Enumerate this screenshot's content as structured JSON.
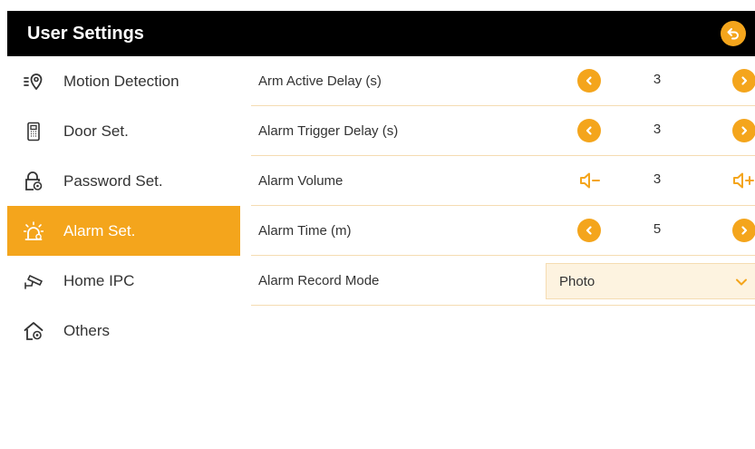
{
  "header": {
    "title": "User Settings",
    "back_icon": "back-arrow-icon"
  },
  "colors": {
    "accent": "#f4a51c",
    "titlebar": "#000000",
    "divider": "#f5dcb2",
    "select_bg": "#fdf3e0"
  },
  "sidebar": {
    "items": [
      {
        "label": "Motion Detection",
        "icon": "motion-sensor-icon",
        "active": false
      },
      {
        "label": "Door Set.",
        "icon": "door-phone-icon",
        "active": false
      },
      {
        "label": "Password Set.",
        "icon": "lock-settings-icon",
        "active": false
      },
      {
        "label": "Alarm Set.",
        "icon": "alarm-light-icon",
        "active": true
      },
      {
        "label": "Home IPC",
        "icon": "cctv-camera-icon",
        "active": false
      },
      {
        "label": "Others",
        "icon": "home-settings-icon",
        "active": false
      }
    ]
  },
  "settings": {
    "rows": [
      {
        "label": "Arm Active Delay (s)",
        "value": "3",
        "control": "stepper",
        "dec_icon": "chevron-left-icon",
        "inc_icon": "chevron-right-icon"
      },
      {
        "label": "Alarm Trigger Delay (s)",
        "value": "3",
        "control": "stepper",
        "dec_icon": "chevron-left-icon",
        "inc_icon": "chevron-right-icon"
      },
      {
        "label": "Alarm Volume",
        "value": "3",
        "control": "volume",
        "dec_icon": "volume-down-icon",
        "inc_icon": "volume-up-icon"
      },
      {
        "label": "Alarm Time (m)",
        "value": "5",
        "control": "stepper",
        "dec_icon": "chevron-left-icon",
        "inc_icon": "chevron-right-icon"
      },
      {
        "label": "Alarm Record Mode",
        "value": "Photo",
        "control": "select",
        "dropdown_icon": "chevron-down-icon"
      }
    ]
  }
}
